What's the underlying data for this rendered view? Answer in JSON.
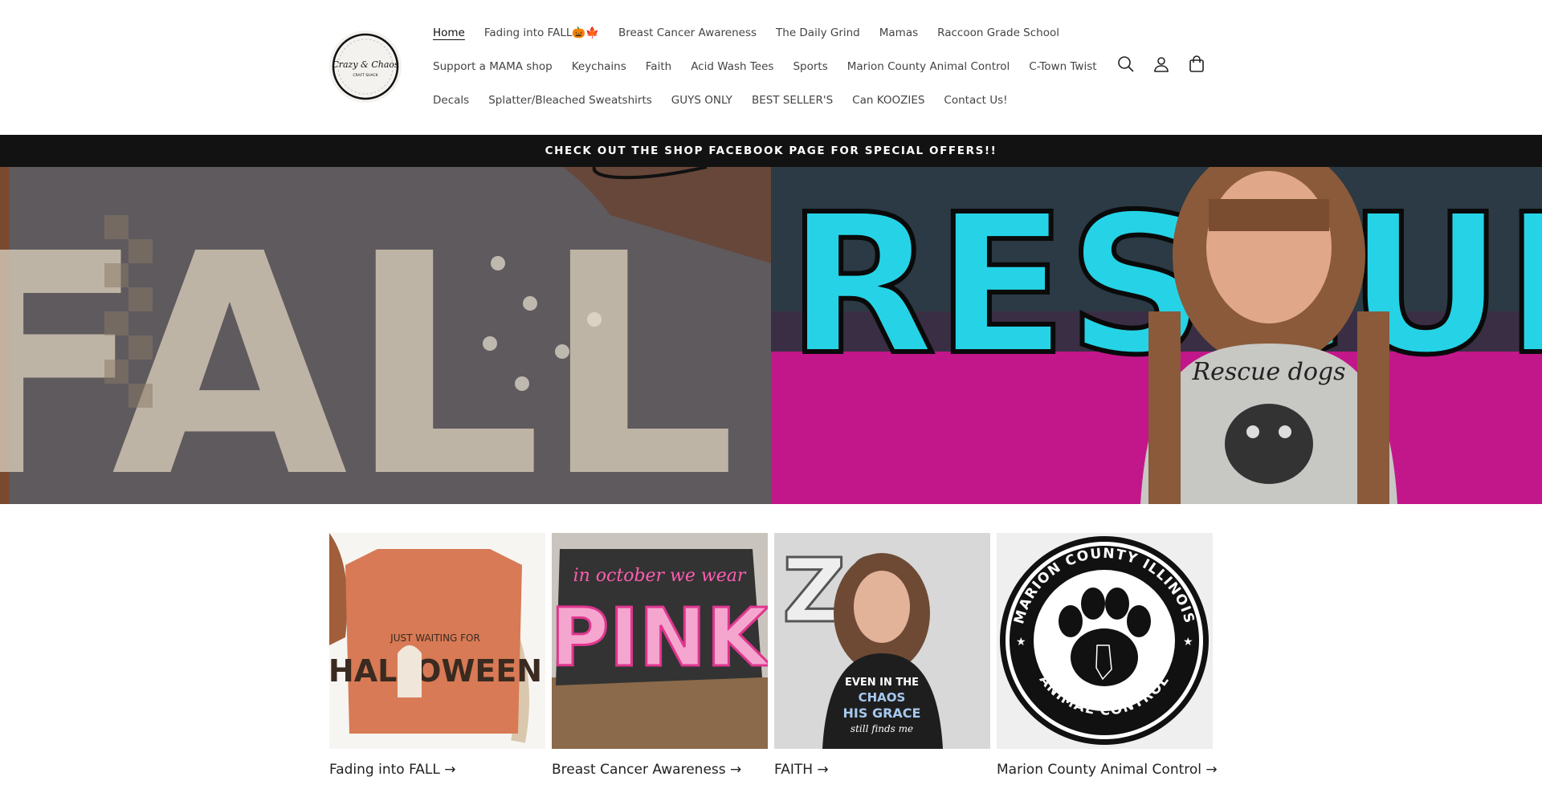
{
  "header": {
    "logo": {
      "alt": "Crazy & Chaos Craft Shack",
      "text_line1": "Crazy & Chaos",
      "text_line2": "CRAFT SHACK"
    },
    "nav": {
      "row1": [
        "Home",
        "Fading into FALL🎃🍁",
        "Breast Cancer Awareness",
        "The Daily Grind",
        "Mamas",
        "Raccoon Grade School"
      ],
      "row2": [
        "Support a MAMA shop",
        "Keychains",
        "Faith",
        "Acid Wash Tees",
        "Sports",
        "Marion County Animal Control",
        "C-Town Twist"
      ],
      "row3": [
        "Decals",
        "Splatter/Bleached Sweatshirts",
        "GUYS ONLY",
        "BEST SELLER'S",
        "Can KOOZIES",
        "Contact Us!"
      ]
    },
    "icons": [
      "search-icon",
      "account-icon",
      "cart-icon"
    ]
  },
  "announcement": {
    "text": "CHECK OUT THE SHOP FACEBOOK PAGE FOR SPECIAL OFFERS!!"
  },
  "hero": {
    "left": {
      "graphic_text": "FALL"
    },
    "right": {
      "graphic_text": "RESCUE",
      "shirt_text": "Rescue dogs"
    }
  },
  "collections": [
    {
      "title": "Fading into FALL →",
      "art_line1": "JUST WAITING FOR",
      "art_line2": "HALLOWEEN"
    },
    {
      "title": "Breast Cancer Awareness →",
      "art_line1": "in october we wear",
      "art_line2": "PINK"
    },
    {
      "title": "FAITH →",
      "art_line1": "EVEN IN THE",
      "art_line2": "CHAOS",
      "art_line3": "HIS GRACE",
      "art_line4": "still finds me"
    },
    {
      "title": "Marion County Animal Control →",
      "art_top": "MARION COUNTY ILLINOIS",
      "art_bottom": "ANIMAL CONTROL"
    }
  ],
  "colors": {
    "announcement_bg": "#121212",
    "text": "#333333"
  }
}
